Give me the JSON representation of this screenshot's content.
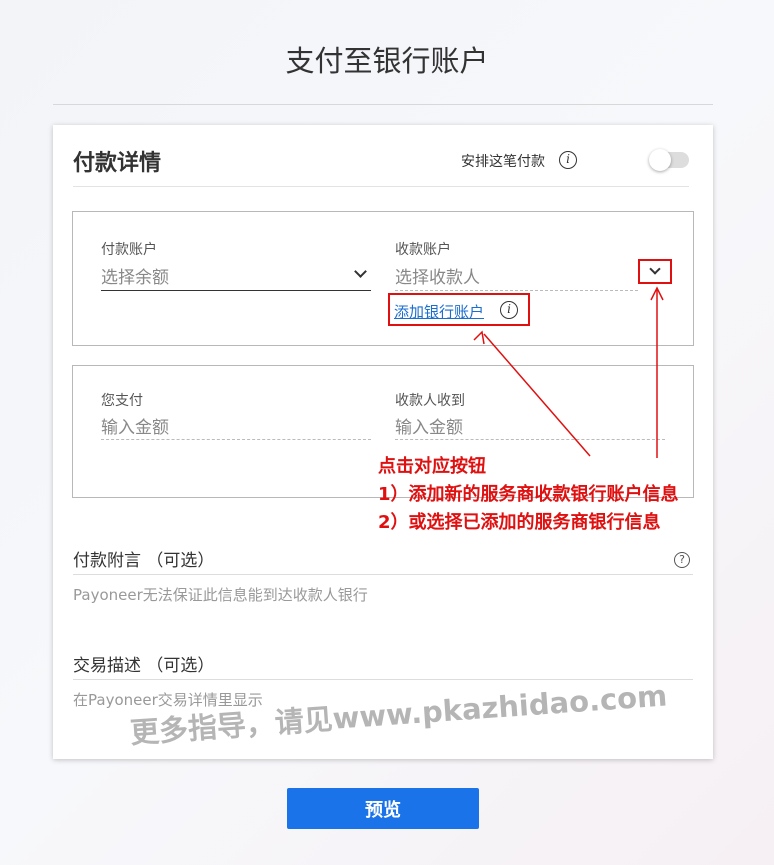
{
  "page": {
    "title": "支付至银行账户"
  },
  "details": {
    "title": "付款详情",
    "schedule_label": "安排这笔付款",
    "schedule_enabled": false
  },
  "payment_account": {
    "label": "付款账户",
    "placeholder": "选择余额"
  },
  "recipient_account": {
    "label": "收款账户",
    "placeholder": "选择收款人",
    "add_link": "添加银行账户"
  },
  "you_pay": {
    "label": "您支付",
    "placeholder": "输入金额"
  },
  "recipient_gets": {
    "label": "收款人收到",
    "placeholder": "输入金额"
  },
  "payment_note": {
    "label": "付款附言 （可选）",
    "hint": "Payoneer无法保证此信息能到达收款人银行"
  },
  "description": {
    "label": "交易描述 （可选）",
    "hint": "在Payoneer交易详情里显示"
  },
  "preview_button": "预览",
  "annotation": {
    "line1": "点击对应按钮",
    "line2": "1）添加新的服务商收款银行账户信息",
    "line3": "2）或选择已添加的服务商银行信息"
  },
  "watermark": "更多指导，请见www.pkazhidao.com",
  "colors": {
    "accent": "#1a73e8",
    "link": "#1a6ed0",
    "annotation": "#e01010"
  },
  "icons": {
    "info": "info-icon",
    "help": "question-icon",
    "dropdown": "chevron-down-icon"
  }
}
